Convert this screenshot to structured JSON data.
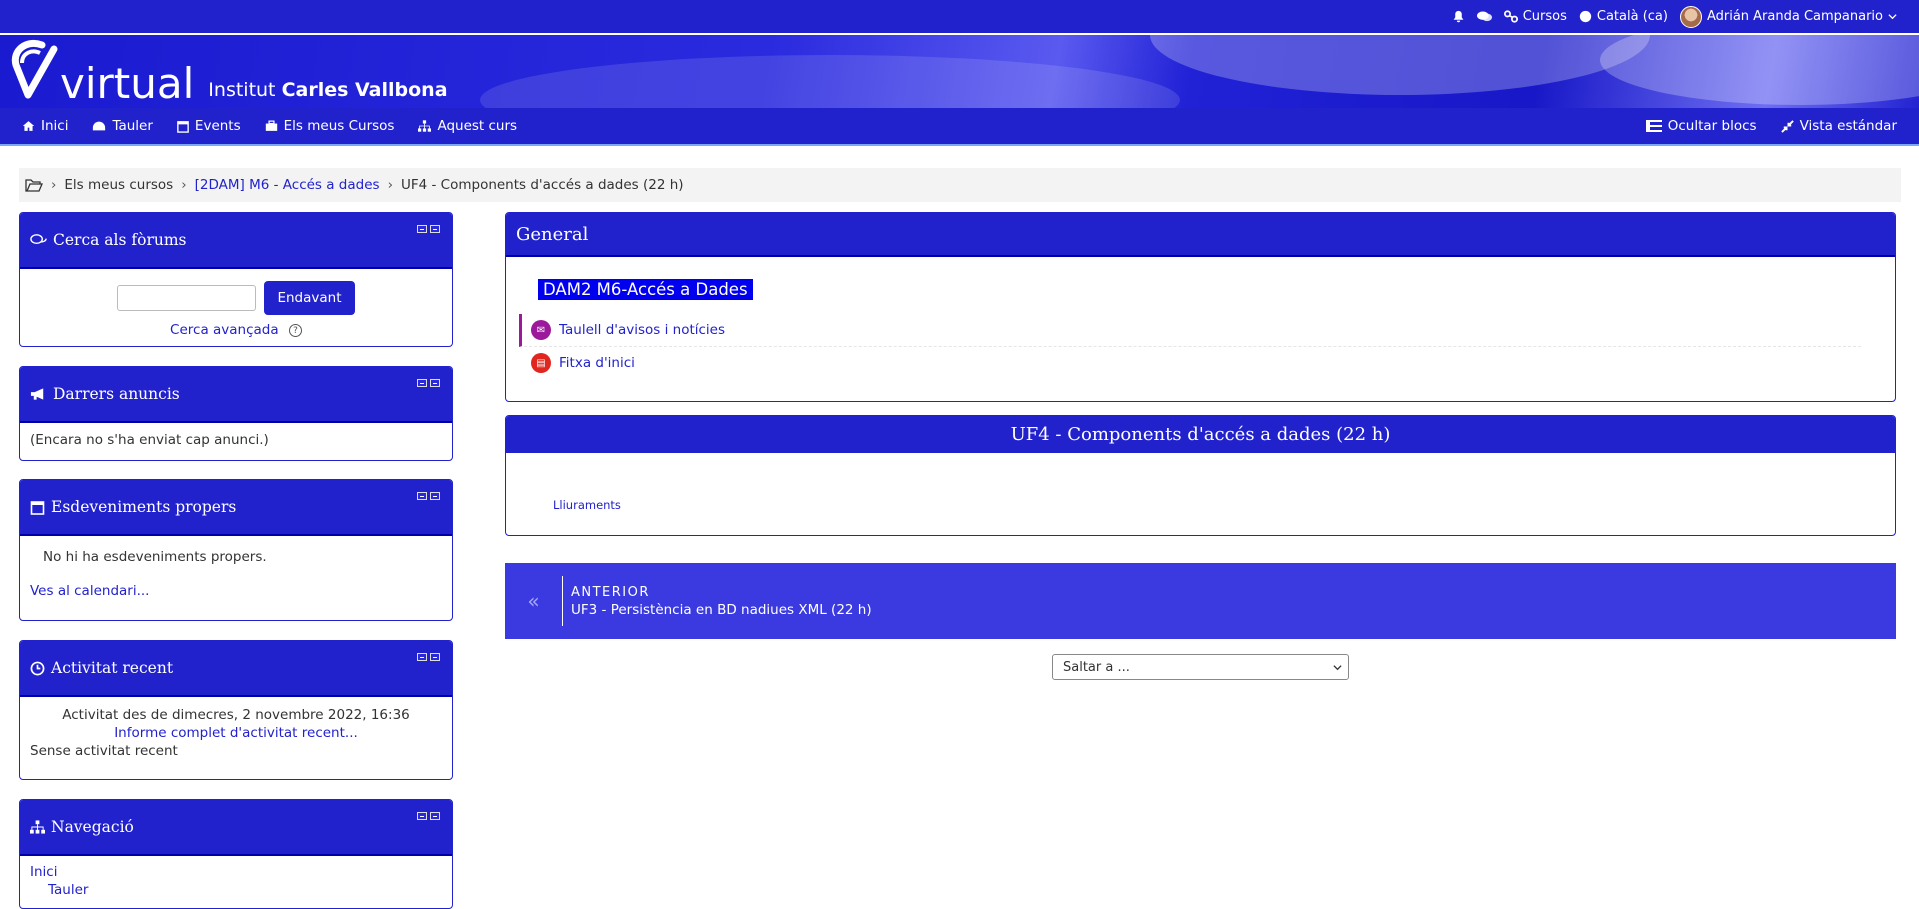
{
  "topbar": {
    "courses_label": "Cursos",
    "language_label": "Català (ca)",
    "user_name": "Adrián Aranda Campanario"
  },
  "banner": {
    "logo_text": "virtual",
    "institute_prefix": "Institut",
    "institute_name": "Carles Vallbona"
  },
  "nav": {
    "items": [
      {
        "label": "Inici",
        "icon": "home-icon"
      },
      {
        "label": "Tauler",
        "icon": "dashboard-icon"
      },
      {
        "label": "Events",
        "icon": "calendar-icon"
      },
      {
        "label": "Els meus Cursos",
        "icon": "briefcase-icon"
      },
      {
        "label": "Aquest curs",
        "icon": "sitemap-icon"
      }
    ],
    "hide_blocks": "Ocultar blocs",
    "standard_view": "Vista estándar"
  },
  "breadcrumb": {
    "item1": "Els meus cursos",
    "item2": "[2DAM] M6 - Accés a dades",
    "item3": "UF4 - Components d'accés a dades (22 h)"
  },
  "blocks": {
    "search": {
      "title": "Cerca als fòrums",
      "button": "Endavant",
      "advanced": "Cerca avançada",
      "help": "?"
    },
    "news": {
      "title": "Darrers anuncis",
      "empty": "(Encara no s'ha enviat cap anunci.)"
    },
    "events": {
      "title": "Esdeveniments propers",
      "empty": "No hi ha esdeveniments propers.",
      "calendar_link": "Ves al calendari..."
    },
    "recent": {
      "title": "Activitat recent",
      "since": "Activitat des de dimecres, 2 novembre 2022, 16:36",
      "report_link": "Informe complet d'activitat recent...",
      "none": "Sense activitat recent"
    },
    "navigation": {
      "title": "Navegació",
      "item1": "Inici",
      "item2": "Tauler"
    }
  },
  "general": {
    "title": "General",
    "course_tag": "DAM2   M6-Accés a Dades",
    "activities": [
      {
        "label": "Taulell d'avisos i notícies",
        "icon": "forum-icon",
        "color": "#9b1a9b"
      },
      {
        "label": "Fitxa d'inici",
        "icon": "pdf-icon",
        "color": "#e0261e"
      }
    ]
  },
  "section": {
    "title": "UF4 - Components d'accés a dades (22 h)",
    "link": "Lliuraments"
  },
  "prev": {
    "kicker": "ANTERIOR",
    "title": "UF3 - Persistència en BD nadiues XML (22 h)",
    "arrow": "«"
  },
  "jump": {
    "label": "Saltar a ..."
  }
}
